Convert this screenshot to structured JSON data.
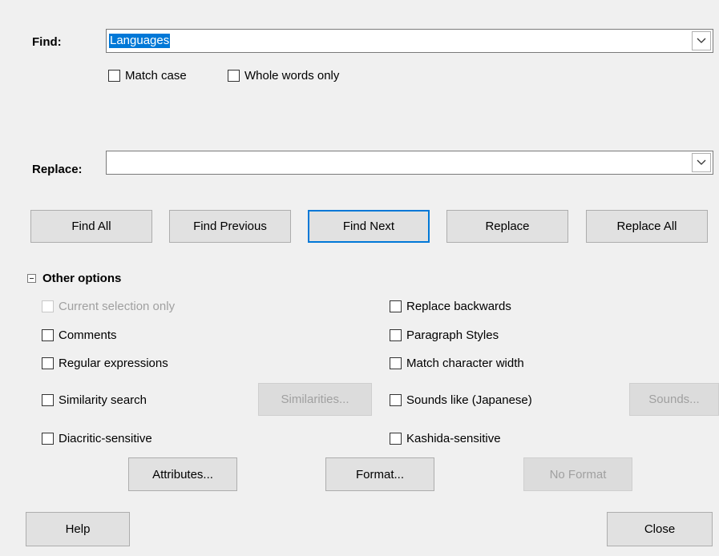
{
  "find": {
    "label": "Find:",
    "value": "Languages",
    "match_case": "Match case",
    "whole_words": "Whole words only"
  },
  "replace": {
    "label": "Replace:",
    "value": ""
  },
  "actions": {
    "find_all": "Find All",
    "find_previous": "Find Previous",
    "find_next": "Find Next",
    "replace": "Replace",
    "replace_all": "Replace All"
  },
  "other_options": {
    "title": "Other options",
    "current_selection_only": "Current selection only",
    "comments": "Comments",
    "regular_expressions": "Regular expressions",
    "similarity_search": "Similarity search",
    "similarities_button": "Similarities...",
    "diacritic_sensitive": "Diacritic-sensitive",
    "replace_backwards": "Replace backwards",
    "paragraph_styles": "Paragraph Styles",
    "match_character_width": "Match character width",
    "sounds_like": "Sounds like (Japanese)",
    "sounds_button": "Sounds...",
    "kashida_sensitive": "Kashida-sensitive",
    "attributes_button": "Attributes...",
    "format_button": "Format...",
    "no_format_button": "No Format"
  },
  "footer": {
    "help": "Help",
    "close": "Close"
  },
  "icons": {
    "dropdown": "chevron-down-icon",
    "collapse": "minus-box-icon"
  },
  "colors": {
    "selection": "#0078d7",
    "background": "#f0f0f0"
  }
}
